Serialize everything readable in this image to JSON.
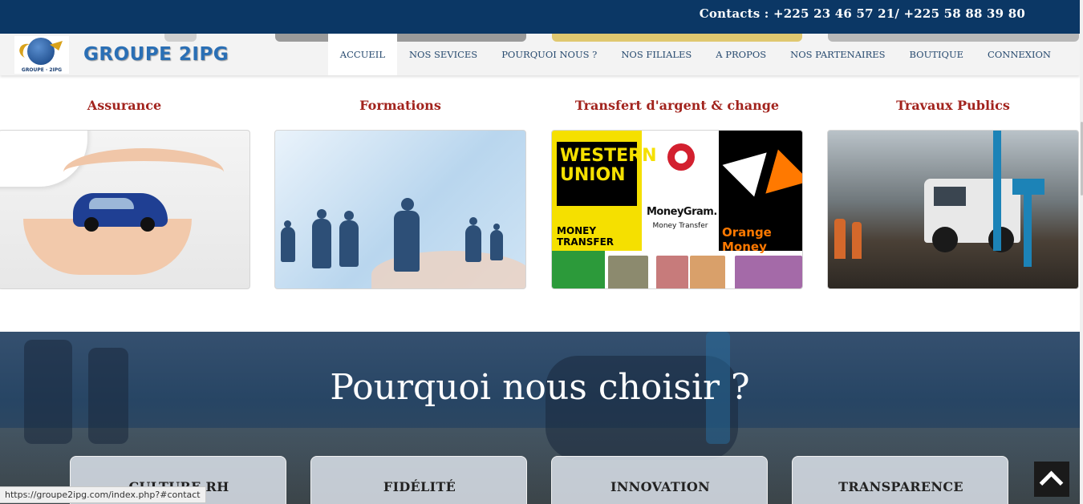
{
  "topbar": {
    "contacts": "Contacts : +225 23 46 57 21/ +225 58 88 39 80"
  },
  "header": {
    "brand": "GROUPE 2IPG",
    "logo_caption": "GROUPE · 2IPG"
  },
  "nav": {
    "items": [
      {
        "label": "ACCUEIL",
        "active": true
      },
      {
        "label": "NOS SEVICES",
        "active": false
      },
      {
        "label": "POURQUOI NOUS ?",
        "active": false
      },
      {
        "label": "NOS FILIALES",
        "active": false
      },
      {
        "label": "A PROPOS",
        "active": false
      },
      {
        "label": "NOS PARTENAIRES",
        "active": false
      },
      {
        "label": "BOUTIQUE",
        "active": false
      },
      {
        "label": "CONNEXION",
        "active": false
      }
    ]
  },
  "services": [
    {
      "title": "Assurance"
    },
    {
      "title": "Formations"
    },
    {
      "title": "Transfert d'argent & change"
    },
    {
      "title": "Travaux Publics"
    }
  ],
  "transfer_logos": {
    "wu": "WESTERN UNION",
    "wu_sub": "MONEY TRANSFER",
    "mg": "MoneyGram.",
    "mg_sub": "Money Transfer",
    "om": "Orange Money"
  },
  "why": {
    "title": "Pourquoi nous choisir ?",
    "values": [
      "CULTURE RH",
      "FIDÉLITÉ",
      "INNOVATION",
      "TRANSPARENCE"
    ]
  },
  "status_url": "https://groupe2ipg.com/index.php?#contact",
  "colors": {
    "topbar": "#0b3765",
    "brand": "#2a6fb5",
    "service_title": "#a2231d",
    "nav_text": "#274a6f"
  },
  "icons": {
    "back_to_top": "chevron-up-icon"
  }
}
